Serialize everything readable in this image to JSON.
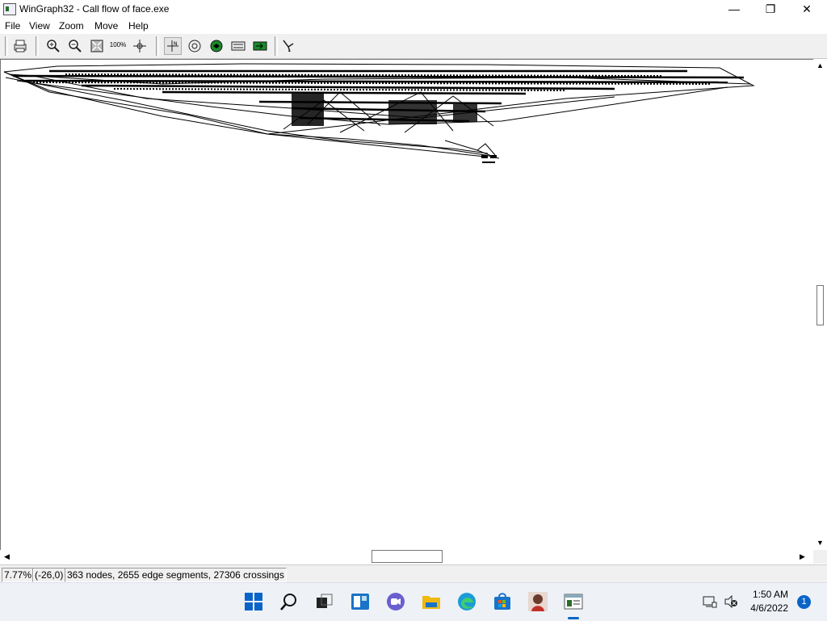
{
  "window": {
    "title": "WinGraph32 - Call flow of face.exe",
    "controls": {
      "minimize": "—",
      "maximize": "❐",
      "close": "✕"
    }
  },
  "menu": [
    "File",
    "View",
    "Zoom",
    "Move",
    "Help"
  ],
  "toolbar": {
    "buttons": [
      "print-icon",
      "zoom-in-icon",
      "zoom-out-icon",
      "fit-window-icon",
      "zoom-100-icon",
      "center-icon",
      "layout-icon",
      "circle-icon",
      "green-dot-icon",
      "folding-icon",
      "green-arrow-icon",
      "edge-icon"
    ],
    "zoom100_label": "100%"
  },
  "graph": {
    "description_hidden": "",
    "edge_color": "#000000"
  },
  "status": {
    "zoom": "7.77%",
    "coords": "(-26,0)",
    "stats": "363 nodes, 2655 edge segments, 27306 crossings"
  },
  "taskbar": {
    "icons": [
      "start-icon",
      "search-icon",
      "task-view-icon",
      "widgets-icon",
      "chat-icon",
      "file-explorer-icon",
      "edge-icon",
      "store-icon",
      "user-app-icon",
      "wingraph-icon"
    ],
    "clock_time": "1:50 AM",
    "clock_date": "4/6/2022",
    "notification_count": "1"
  },
  "colors": {
    "accent": "#0a64c8",
    "graph": "#000000"
  }
}
